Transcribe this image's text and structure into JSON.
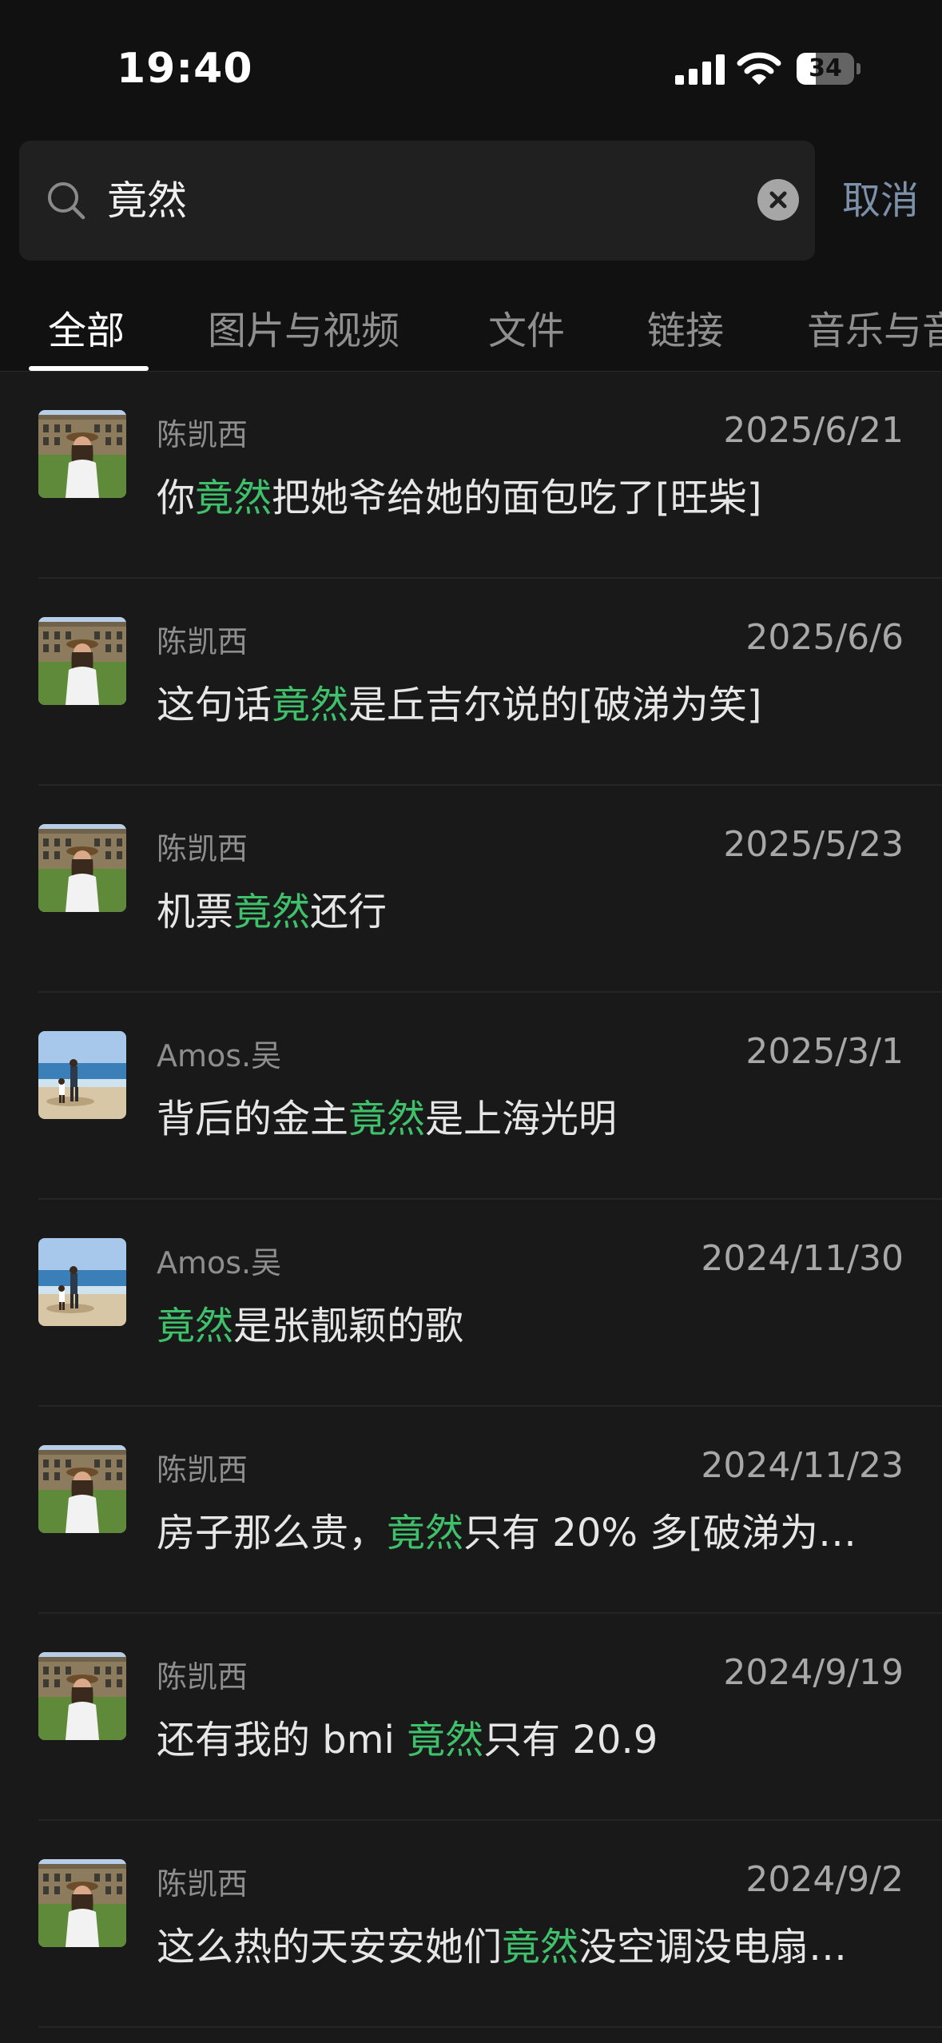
{
  "status_bar": {
    "time": "19:40",
    "battery_percent": "34",
    "battery_level": 0.34,
    "signal_bars": 4,
    "icons": [
      "cellular-signal-icon",
      "wifi-icon",
      "battery-icon"
    ]
  },
  "search": {
    "query": "竟然",
    "cancel_label": "取消",
    "icons": [
      "search-icon",
      "clear-icon"
    ]
  },
  "tabs": [
    {
      "label": "全部",
      "active": true
    },
    {
      "label": "图片与视频",
      "active": false
    },
    {
      "label": "文件",
      "active": false
    },
    {
      "label": "链接",
      "active": false
    },
    {
      "label": "音乐与音",
      "active": false
    }
  ],
  "colors": {
    "highlight": "#3fc16b",
    "background": "#191919",
    "cancel_link": "#7d90a9"
  },
  "results": [
    {
      "sender": "陈凯西",
      "date": "2025/6/21",
      "avatar": "castle-portrait-avatar",
      "message": {
        "before": "你",
        "match": "竟然",
        "after": "把她爷给她的面包吃了[旺柴]"
      }
    },
    {
      "sender": "陈凯西",
      "date": "2025/6/6",
      "avatar": "castle-portrait-avatar",
      "message": {
        "before": "这句话",
        "match": "竟然",
        "after": "是丘吉尔说的[破涕为笑]"
      }
    },
    {
      "sender": "陈凯西",
      "date": "2025/5/23",
      "avatar": "castle-portrait-avatar",
      "message": {
        "before": "机票",
        "match": "竟然",
        "after": "还行"
      }
    },
    {
      "sender": "Amos.吴",
      "date": "2025/3/1",
      "avatar": "beach-avatar",
      "message": {
        "before": "背后的金主",
        "match": "竟然",
        "after": "是上海光明"
      }
    },
    {
      "sender": "Amos.吴",
      "date": "2024/11/30",
      "avatar": "beach-avatar",
      "message": {
        "before": "",
        "match": "竟然",
        "after": "是张靓颖的歌"
      }
    },
    {
      "sender": "陈凯西",
      "date": "2024/11/23",
      "avatar": "castle-portrait-avatar",
      "message": {
        "before": "房子那么贵，",
        "match": "竟然",
        "after": "只有 20% 多[破涕为…"
      }
    },
    {
      "sender": "陈凯西",
      "date": "2024/9/19",
      "avatar": "castle-portrait-avatar",
      "message": {
        "before": "还有我的 bmi ",
        "match": "竟然",
        "after": "只有 20.9"
      }
    },
    {
      "sender": "陈凯西",
      "date": "2024/9/2",
      "avatar": "castle-portrait-avatar",
      "message": {
        "before": "这么热的天安安她们",
        "match": "竟然",
        "after": "没空调没电扇…"
      }
    }
  ]
}
